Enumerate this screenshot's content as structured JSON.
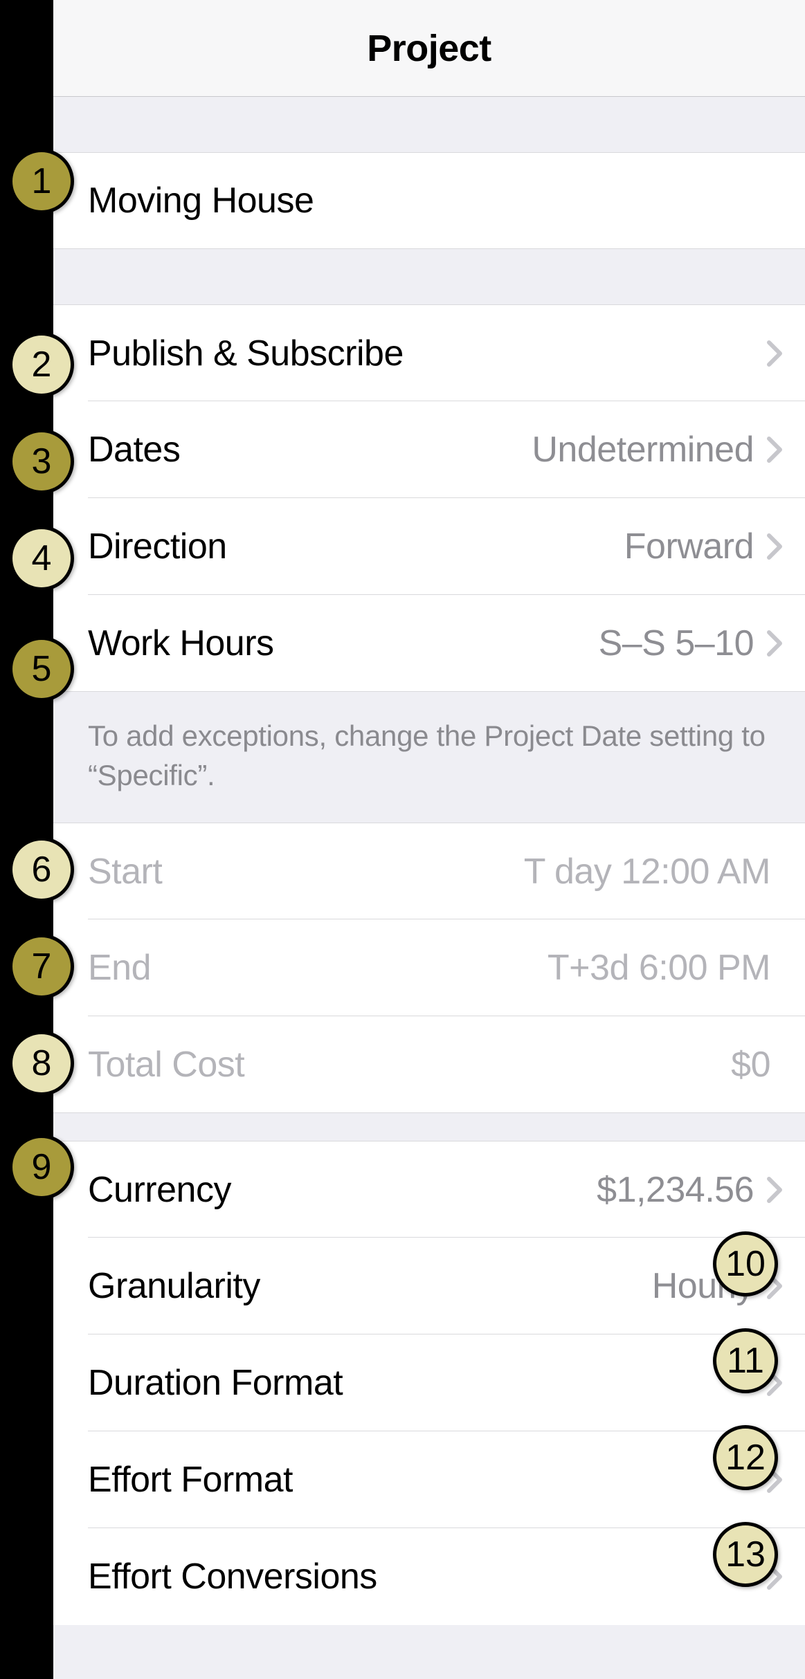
{
  "header": {
    "title": "Project"
  },
  "project_name": "Moving House",
  "settings": {
    "publish_subscribe": {
      "label": "Publish & Subscribe"
    },
    "dates": {
      "label": "Dates",
      "value": "Undetermined"
    },
    "direction": {
      "label": "Direction",
      "value": "Forward"
    },
    "work_hours": {
      "label": "Work Hours",
      "value": "S–S 5–10"
    }
  },
  "footer_note": "To add exceptions, change the Project Date setting to “Specific”.",
  "computed": {
    "start": {
      "label": "Start",
      "value": "T day 12:00 AM"
    },
    "end": {
      "label": "End",
      "value": "T+3d 6:00 PM"
    },
    "total_cost": {
      "label": "Total Cost",
      "value": "$0"
    }
  },
  "format": {
    "currency": {
      "label": "Currency",
      "value": "$1,234.56"
    },
    "granularity": {
      "label": "Granularity",
      "value": "Hourly"
    },
    "duration_format": {
      "label": "Duration Format",
      "value": ""
    },
    "effort_format": {
      "label": "Effort Format",
      "value": ""
    },
    "effort_conversions": {
      "label": "Effort Conversions",
      "value": ""
    }
  },
  "badges": [
    "1",
    "2",
    "3",
    "4",
    "5",
    "6",
    "7",
    "8",
    "9",
    "10",
    "11",
    "12",
    "13"
  ]
}
